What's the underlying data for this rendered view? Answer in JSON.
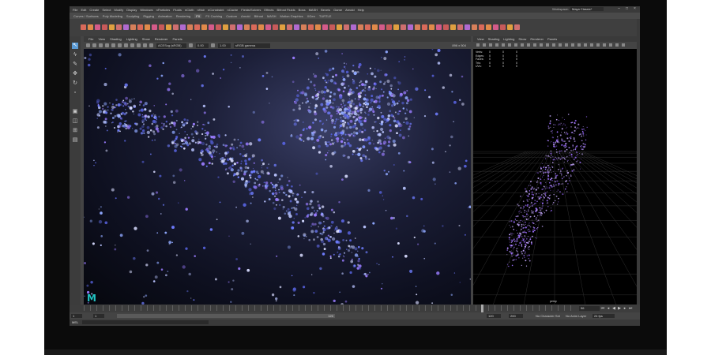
{
  "menubar": {
    "items": [
      "File",
      "Edit",
      "Create",
      "Select",
      "Modify",
      "Display",
      "Windows",
      "nParticles",
      "Fluids",
      "nCloth",
      "nHair",
      "nConstraint",
      "nCache",
      "Fields/Solvers",
      "Effects",
      "Bifrost Fluids",
      "Boss",
      "MASH",
      "Bevels",
      "Game",
      "Arnold",
      "Help"
    ],
    "workspace_label": "Workspace:",
    "workspace_value": "Maya Classic*"
  },
  "shelf_tabs": [
    "Curves / Surfaces",
    "Poly Modeling",
    "Sculpting",
    "Rigging",
    "Animation",
    "Rendering",
    "FX",
    "FX Caching",
    "Custom",
    "Arnold",
    "Bifrost",
    "MASH",
    "Motion Graphics",
    "XGen",
    "TURTLE"
  ],
  "shelf_active_tab_index": 6,
  "main_viewport": {
    "menu": [
      "File",
      "View",
      "Shading",
      "Lighting",
      "Show",
      "Renderer",
      "Panels"
    ],
    "toolbar": {
      "color_space": "ACEScg (sRGB)",
      "value_a": "0.00",
      "value_b": "1.00",
      "display": "sRGB gamma",
      "resolution": "896 x 504"
    }
  },
  "side_viewport": {
    "menu": [
      "View",
      "Shading",
      "Lighting",
      "Show",
      "Renderer",
      "Panels"
    ],
    "hud": [
      [
        "Verts:",
        "0",
        "0",
        "0"
      ],
      [
        "Edges:",
        "0",
        "0",
        "0"
      ],
      [
        "Faces:",
        "0",
        "0",
        "0"
      ],
      [
        "Tris:",
        "0",
        "0",
        "0"
      ],
      [
        "UVs:",
        "0",
        "0",
        "0"
      ]
    ],
    "camera_label": "persp"
  },
  "logo": {
    "text": "M",
    "color": "#21c3c3"
  },
  "timeslider": {
    "current_frame": "96",
    "playback_icons": [
      "first-frame",
      "prev-key",
      "play-back",
      "play-forward",
      "next-key",
      "last-frame"
    ]
  },
  "range_slider": {
    "start": "1",
    "start_inner": "1",
    "range_end": "120",
    "end_inner": "120",
    "end": "200",
    "character_set": "No Character Set",
    "anim_layer": "No Anim Layer",
    "fps": "24 fps"
  },
  "command_line": {
    "language": "MEL"
  },
  "colors": {
    "ui_panel": "#444444",
    "ui_dark": "#3a3a3a",
    "accent_blue": "#5b9bd5",
    "particle_blue": "#7a7aff",
    "particle_purple": "#9b6bff",
    "maya_teal": "#21c3c3"
  }
}
